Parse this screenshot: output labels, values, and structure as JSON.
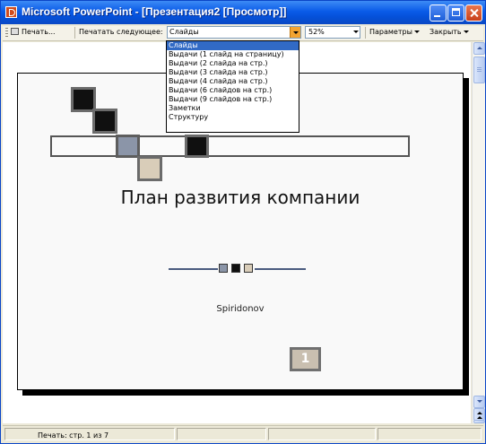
{
  "window": {
    "title": "Microsoft PowerPoint - [Презентация2 [Просмотр]]"
  },
  "toolbar": {
    "print_label": "Печать...",
    "print_what_label": "Печатать следующее:",
    "print_what_value": "Слайды",
    "zoom_value": "52%",
    "params_label": "Параметры",
    "close_label": "Закрыть"
  },
  "print_what_options": [
    "Слайды",
    "Выдачи (1 слайд на страницу)",
    "Выдачи (2 слайда на стр.)",
    "Выдачи (3 слайда на стр.)",
    "Выдачи (4 слайда на стр.)",
    "Выдачи (6 слайдов на стр.)",
    "Выдачи (9 слайдов на стр.)",
    "Заметки",
    "Структуру"
  ],
  "slide": {
    "title": "План развития компании",
    "subtitle": "Spiridonov",
    "page_number": "1"
  },
  "status": {
    "page_info": "Печать: стр. 1 из 7"
  },
  "colors": {
    "title_bar": "#0a5be8",
    "selection": "#316ac5",
    "accent_dark": "#101010",
    "accent_grey": "#8b95a8",
    "accent_beige": "#d9cdb9"
  }
}
